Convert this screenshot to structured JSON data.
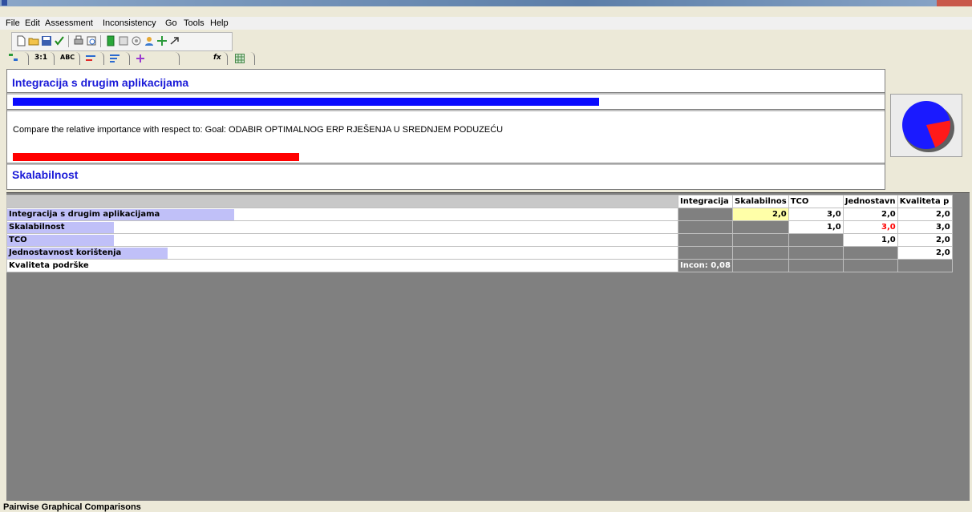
{
  "menu": [
    "File",
    "Edit",
    "Assessment",
    "Inconsistency",
    "Go",
    "Tools",
    "Help"
  ],
  "tabs": [
    {
      "label": "3:1"
    },
    {
      "label": "ABC"
    },
    {
      "label": "fx"
    }
  ],
  "panel": {
    "node_a": "Integracija s drugim aplikacijama",
    "compare_text": "Compare the relative importance with respect to: Goal: ODABIR OPTIMALNOG ERP RJEŠENJA U SREDNJEM PODUZEĆU",
    "node_b": "Skalabilnost",
    "node_a_weight": 0.86,
    "node_b_weight": 0.42,
    "colors": {
      "node_a": "#0b0bff",
      "node_b": "#ff0000"
    },
    "pie": {
      "blue_fraction": 0.78,
      "red_fraction": 0.22
    }
  },
  "matrix": {
    "columns": [
      "Integracija",
      "Skalabilnos",
      "TCO",
      "Jednostavn",
      "Kvaliteta p"
    ],
    "rows": [
      {
        "label": "Integracija s drugim aplikacijama",
        "weight": 0.34,
        "cells": [
          "",
          "2,0",
          "3,0",
          "2,0",
          "2,0"
        ]
      },
      {
        "label": "Skalabilnost",
        "weight": 0.16,
        "cells": [
          "",
          "",
          "1,0",
          "3,0",
          "3,0"
        ]
      },
      {
        "label": "TCO",
        "weight": 0.16,
        "cells": [
          "",
          "",
          "",
          "1,0",
          "2,0"
        ]
      },
      {
        "label": "Jednostavnost korištenja",
        "weight": 0.24,
        "cells": [
          "",
          "",
          "",
          "",
          "2,0"
        ]
      },
      {
        "label": "Kvaliteta podrške",
        "weight": 0,
        "cells": [
          "Incon: 0,08",
          "",
          "",
          "",
          ""
        ]
      }
    ]
  },
  "status": "Pairwise Graphical Comparisons"
}
